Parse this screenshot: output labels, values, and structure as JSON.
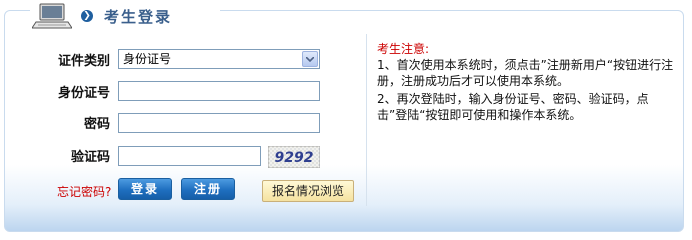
{
  "header": {
    "title": "考生登录",
    "icon": "laptop-icon"
  },
  "form": {
    "id_type_label": "证件类别",
    "id_type_value": "身份证号",
    "id_number_label": "身份证号",
    "password_label": "密码",
    "captcha_label": "验证码",
    "captcha_code": "9292",
    "forgot_link": "忘记密码?",
    "login_button": "登录",
    "register_button": "注册",
    "status_button": "报名情况浏览"
  },
  "notice": {
    "title": "考生注意:",
    "item1": "1、首次使用本系统时，须点击”注册新用户“按钮进行注册，注册成功后才可以使用本系统。",
    "item2": "2、再次登陆时，输入身份证号、密码、验证码，点击”登陆“按钮即可使用和操作本系统。"
  },
  "colors": {
    "accent": "#1f6fbf",
    "title": "#3a5f8c",
    "warning": "#cc0000",
    "border": "#c9dbee"
  }
}
